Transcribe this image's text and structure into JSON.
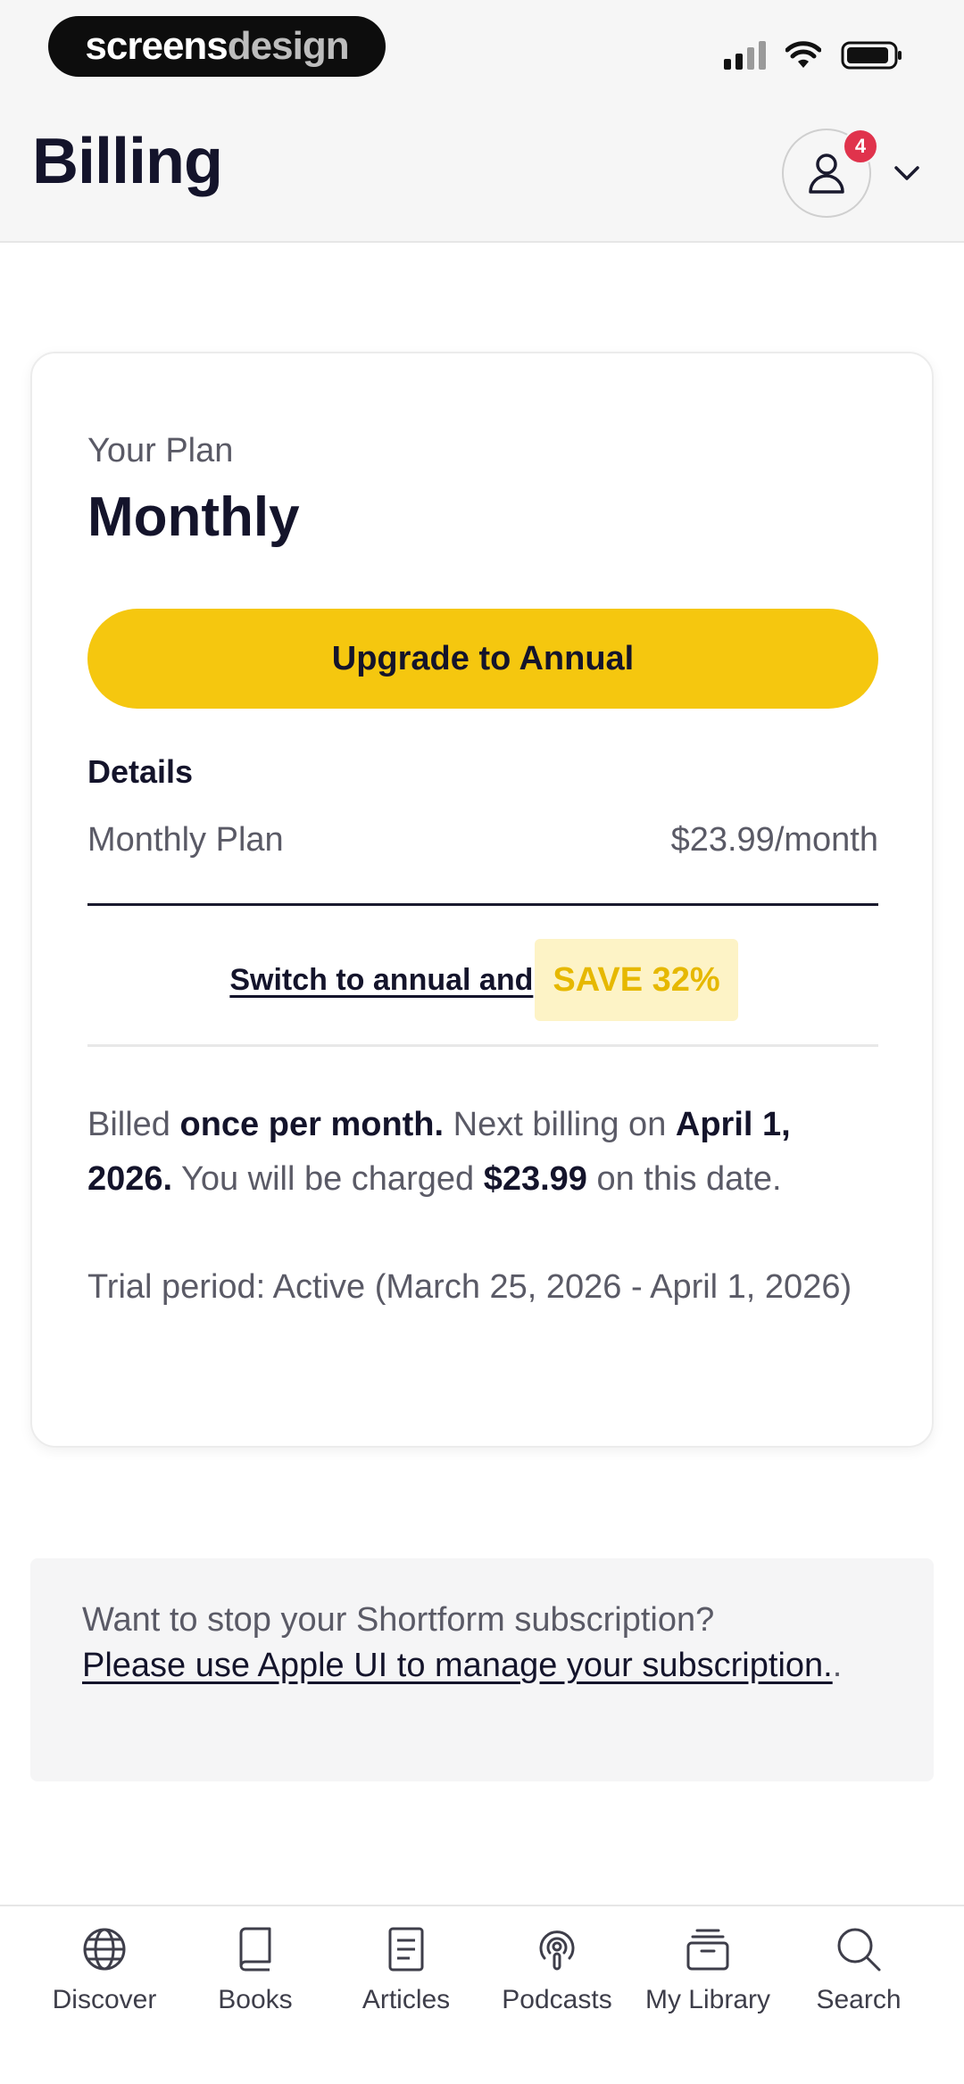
{
  "status_bar": {
    "brand_part1": "screens",
    "brand_part2": "design"
  },
  "header": {
    "title": "Billing",
    "notification_count": "4",
    "icons": [
      "user-icon",
      "chevron-down-icon"
    ]
  },
  "plan": {
    "label": "Your Plan",
    "name": "Monthly",
    "upgrade_button": "Upgrade to Annual",
    "details_heading": "Details",
    "detail_label": "Monthly Plan",
    "detail_price": "$23.99/month",
    "switch_text": "Switch to annual and",
    "save_badge": "SAVE 32%",
    "billed": {
      "p1": "Billed ",
      "b1": "once per month.",
      "p2": " Next billing on ",
      "b2": "April 1, 2026.",
      "p3": " You will be charged ",
      "b3": "$23.99",
      "p4": " on this date."
    },
    "trial": "Trial period: Active (March 25, 2026 - April 1, 2026)"
  },
  "cancel": {
    "question": "Want to stop your Shortform subscription?",
    "link": "Please use Apple UI to manage your subscription.",
    "suffix": "."
  },
  "bottom_nav": [
    {
      "label": "Discover",
      "icon": "globe-icon"
    },
    {
      "label": "Books",
      "icon": "book-icon"
    },
    {
      "label": "Articles",
      "icon": "document-icon"
    },
    {
      "label": "Podcasts",
      "icon": "podcast-icon"
    },
    {
      "label": "My Library",
      "icon": "library-icon"
    },
    {
      "label": "Search",
      "icon": "search-icon"
    }
  ],
  "colors": {
    "accent_yellow": "#f5c70f",
    "save_badge_bg": "#fdf3c6",
    "save_badge_text": "#e6b800",
    "notification_red": "#e0334c",
    "title_dark": "#14142b"
  }
}
